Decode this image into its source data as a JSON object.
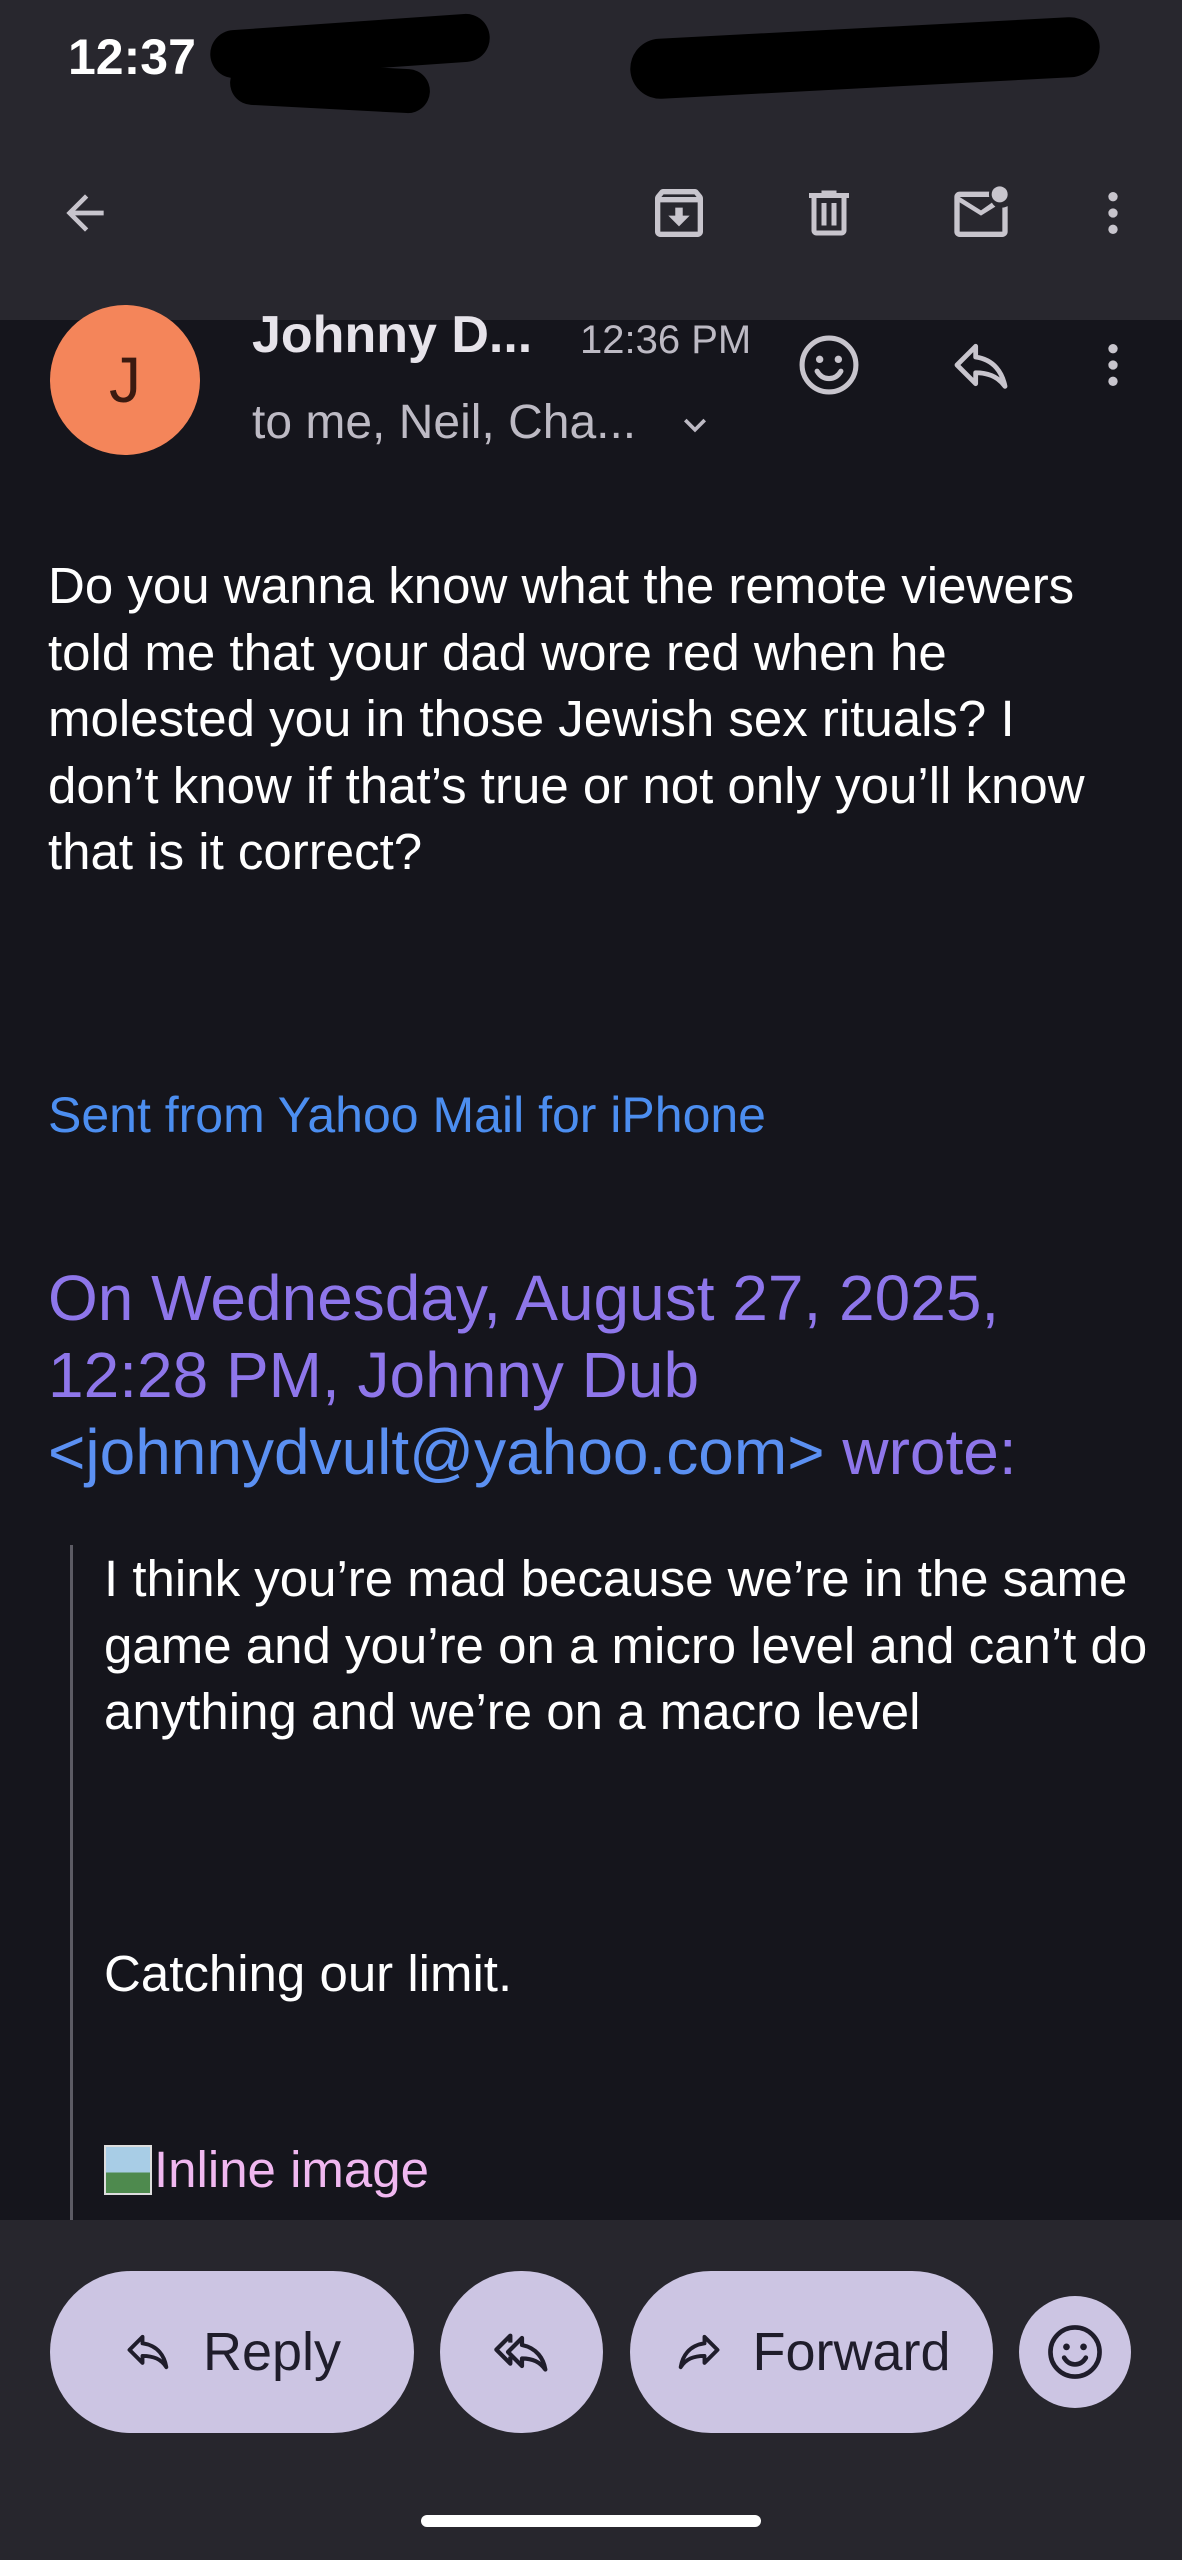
{
  "status_bar": {
    "time": "12:37"
  },
  "toolbar": {
    "back_icon": "arrow-left-icon",
    "archive_icon": "archive-icon",
    "delete_icon": "trash-icon",
    "unread_icon": "mark-unread-icon",
    "more_icon": "more-vert-icon"
  },
  "message": {
    "avatar_initial": "J",
    "avatar_color": "#f4855a",
    "sender": "Johnny D...",
    "time": "12:36 PM",
    "recipients": "to me, Neil, Cha...",
    "body": "Do you wanna know what the remote viewers told me that your dad wore red when he molested you in those Jewish sex rituals? I don’t know if that’s true or not only you’ll know that is it correct?",
    "signature": "Sent from Yahoo Mail for iPhone",
    "quote_header_prefix": "On Wednesday, August 27, 2025, 12:28 PM, Johnny Dub",
    "quote_email": "<johnnydvult@yahoo.com>",
    "quote_header_suffix": "wrote:",
    "quote_body": "I think you’re mad because we’re in the same game and you’re on a micro level and can’t do anything and we’re on a macro level",
    "quote_body_2": "Catching our limit.",
    "inline_image_alt": "Inline image"
  },
  "bottom_bar": {
    "reply_label": "Reply",
    "forward_label": "Forward"
  },
  "colors": {
    "accent_link": "#4c8ef0",
    "quote_header": "#8e76ea",
    "pill_bg": "#ccc5e3"
  }
}
